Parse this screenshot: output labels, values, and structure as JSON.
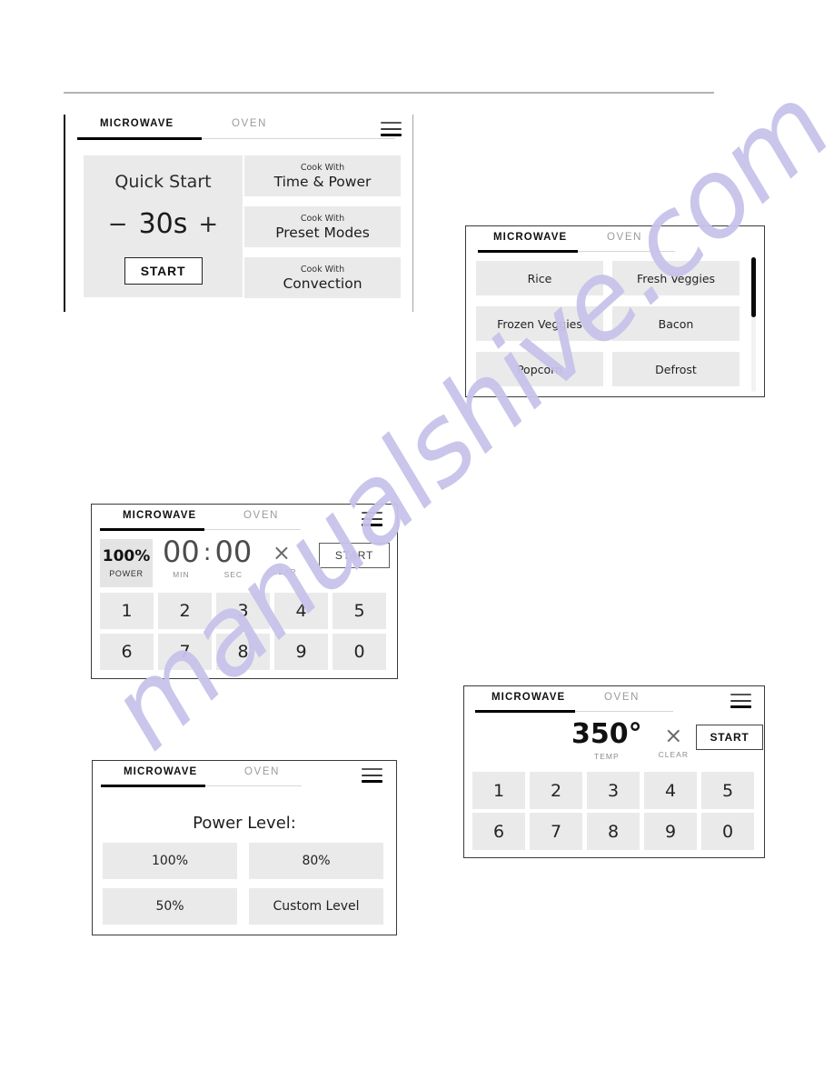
{
  "watermark": {
    "text": "manualshive.com",
    "color": "#c7c2ea"
  },
  "theme": {
    "button_bg": "#eaeaea",
    "active_tab_underline": "#000000",
    "inactive_tab_underline": "#d6d6d6",
    "panel_border": "#3a3a3a",
    "scroll_thumb": "#0b0b0b"
  },
  "tabs": {
    "microwave": "MICROWAVE",
    "oven": "OVEN"
  },
  "icons": {
    "menu": "hamburger-menu-icon",
    "clear": "close-x-icon",
    "minus": "minus-icon",
    "plus": "plus-icon"
  },
  "panels": {
    "quick_start": {
      "active_tab": "MICROWAVE",
      "quick_start_title": "Quick Start",
      "time_value": "30s",
      "decrement": "−",
      "increment": "+",
      "start_label": "START",
      "cook_buttons": [
        {
          "small": "Cook With",
          "big": "Time & Power"
        },
        {
          "small": "Cook With",
          "big": "Preset Modes"
        },
        {
          "small": "Cook With",
          "big": "Convection"
        }
      ]
    },
    "presets": {
      "active_tab": "MICROWAVE",
      "items": [
        "Rice",
        "Fresh Veggies",
        "Frozen Veggies",
        "Bacon",
        "Popcorn",
        "Defrost"
      ],
      "scroll_position_percent": 22
    },
    "time_power_keypad": {
      "active_tab": "MICROWAVE",
      "power_value": "100%",
      "power_label": "POWER",
      "minutes_value": "00",
      "minutes_label": "MIN",
      "separator": ":",
      "seconds_value": "00",
      "seconds_label": "SEC",
      "clear_glyph": "×",
      "clear_label": "CLEAR",
      "start_label": "START",
      "keys": [
        "1",
        "2",
        "3",
        "4",
        "5",
        "6",
        "7",
        "8",
        "9",
        "0"
      ]
    },
    "power_level": {
      "active_tab": "MICROWAVE",
      "title": "Power Level:",
      "options": [
        "100%",
        "80%",
        "50%",
        "Custom Level"
      ]
    },
    "oven_keypad": {
      "active_tab": "MICROWAVE",
      "temp_value": "350°",
      "temp_label": "TEMP",
      "clear_glyph": "×",
      "clear_label": "CLEAR",
      "start_label": "START",
      "keys": [
        "1",
        "2",
        "3",
        "4",
        "5",
        "6",
        "7",
        "8",
        "9",
        "0"
      ]
    }
  }
}
